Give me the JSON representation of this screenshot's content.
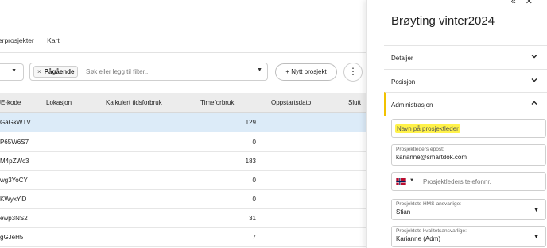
{
  "nav": {
    "tabs": [
      "lerprosjekter",
      "Kart"
    ]
  },
  "toolbar": {
    "filter_chip": "Pågående",
    "filter_chip_remove": "×",
    "filter_placeholder": "Søk eller legg til filter...",
    "new_project_label": "+ Nytt prosjekt",
    "more_icon": "more-vertical-icon"
  },
  "table": {
    "columns": [
      "JE-kode",
      "Lokasjon",
      "Kalkulert tidsforbruk",
      "Timeforbruk",
      "Oppstartsdato",
      "Slutt"
    ],
    "rows": [
      {
        "code": "GaGkWTV",
        "time": "129",
        "selected": true
      },
      {
        "code": "P65W6S7",
        "time": "0"
      },
      {
        "code": "M4pZWc3",
        "time": "183"
      },
      {
        "code": "wg3YoCY",
        "time": "0"
      },
      {
        "code": "KWyxYiD",
        "time": "0"
      },
      {
        "code": "ewp3NS2",
        "time": "31"
      },
      {
        "code": "gGJeH5",
        "time": "7"
      }
    ]
  },
  "drawer": {
    "title": "Brøyting vinter2024",
    "top_icons": [
      "collapse-icon",
      "close-icon"
    ],
    "sections": [
      {
        "label": "Detaljer",
        "expanded": false
      },
      {
        "label": "Posisjon",
        "expanded": false
      },
      {
        "label": "Administrasjon",
        "expanded": true
      }
    ],
    "form": {
      "manager_name_placeholder": "Navn på prosjektleder",
      "manager_email_label": "Prosjektleders epost:",
      "manager_email_value": "karianne@smartdok.com",
      "phone_placeholder": "Prosjektleders telefonnr.",
      "hms_label": "Prosjektets HMS-ansvarlige:",
      "hms_value": "Stian",
      "quality_label": "Prosjektets kvalitetsansvarlige:",
      "quality_value": "Karianne (Adm)"
    }
  },
  "colors": {
    "accent_highlight": "#fff24a",
    "selected_row": "#dcebf8",
    "active_section_bar": "#f2c200"
  }
}
